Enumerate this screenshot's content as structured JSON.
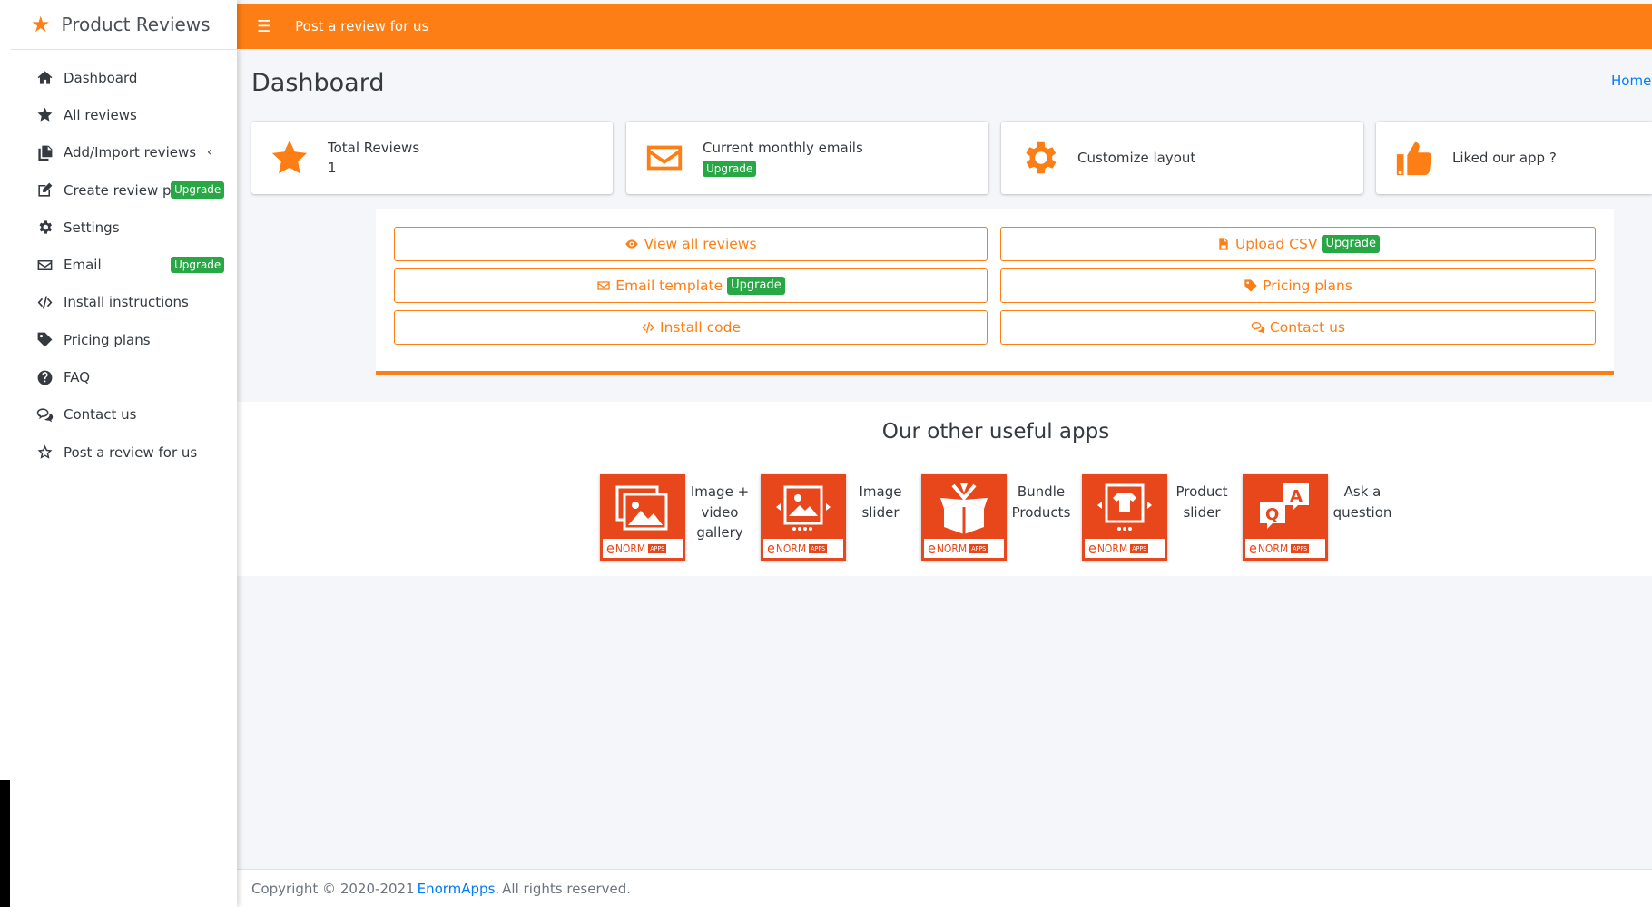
{
  "brand": {
    "title": "Product Reviews"
  },
  "sidebar": {
    "items": [
      {
        "label": "Dashboard",
        "icon": "home-icon"
      },
      {
        "label": "All reviews",
        "icon": "star-icon"
      },
      {
        "label": "Add/Import reviews",
        "icon": "copy-icon"
      },
      {
        "label": "Create review page",
        "icon": "edit-icon",
        "badge": "Upgrade"
      },
      {
        "label": "Settings",
        "icon": "gear-icon"
      },
      {
        "label": "Email",
        "icon": "envelope-icon",
        "badge": "Upgrade"
      },
      {
        "label": "Install instructions",
        "icon": "code-icon"
      },
      {
        "label": "Pricing plans",
        "icon": "tag-icon"
      },
      {
        "label": "FAQ",
        "icon": "question-icon"
      },
      {
        "label": "Contact us",
        "icon": "comments-icon"
      },
      {
        "label": "Post a review for us",
        "icon": "star-outline-icon"
      }
    ]
  },
  "topbar": {
    "post_label": "Post a review for us"
  },
  "page": {
    "title": "Dashboard",
    "breadcrumb": "Home"
  },
  "info_boxes": [
    {
      "label": "Total Reviews",
      "value": "1",
      "icon": "star-icon"
    },
    {
      "label": "Current monthly emails",
      "badge": "Upgrade",
      "icon": "envelope-icon"
    },
    {
      "label": "Customize layout",
      "icon": "gear-icon"
    },
    {
      "label": "Liked our app ?",
      "icon": "thumbs-up-icon"
    }
  ],
  "actions": {
    "view_all": "View all reviews",
    "upload_csv": "Upload CSV",
    "upload_badge": "Upgrade",
    "email_template": "Email template",
    "email_badge": "Upgrade",
    "pricing": "Pricing plans",
    "install_code": "Install code",
    "contact": "Contact us"
  },
  "apps": {
    "heading": "Our other useful apps",
    "tile_brand": "NORM",
    "tile_tag": "APPS",
    "items": [
      {
        "name": "Image + video gallery"
      },
      {
        "name": "Image slider"
      },
      {
        "name": "Bundle Products"
      },
      {
        "name": "Product slider"
      },
      {
        "name": "Ask a question"
      }
    ]
  },
  "footer": {
    "prefix": "Copyright © 2020-2021",
    "link": "EnormApps.",
    "suffix": "All rights reserved."
  },
  "colors": {
    "accent": "#fd7e14",
    "badge": "#28a745",
    "tile": "#e8471c",
    "link": "#007bff"
  }
}
